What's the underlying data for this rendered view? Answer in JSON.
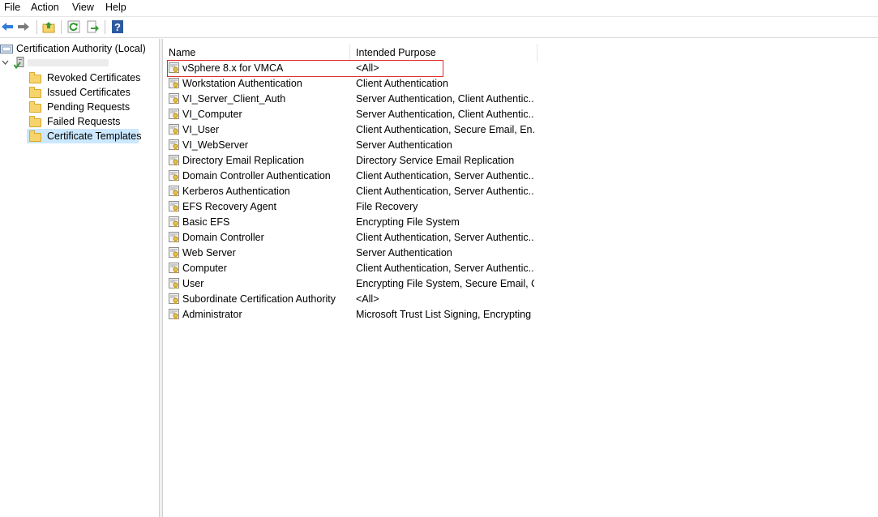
{
  "menu": [
    "File",
    "Action",
    "View",
    "Help"
  ],
  "toolbar": {
    "icons": [
      "back-icon",
      "forward-icon",
      "up-folder-icon",
      "refresh-icon",
      "export-list-icon",
      "help-icon"
    ],
    "help_glyph": "?"
  },
  "tree": {
    "root": "Certification Authority (Local)",
    "ca_name": "",
    "children": [
      "Revoked Certificates",
      "Issued Certificates",
      "Pending Requests",
      "Failed Requests",
      "Certificate Templates"
    ],
    "selected": "Certificate Templates"
  },
  "list": {
    "columns": [
      "Name",
      "Intended Purpose"
    ],
    "rows": [
      {
        "name": "vSphere 8.x for VMCA",
        "purpose": "<All>"
      },
      {
        "name": "Workstation Authentication",
        "purpose": "Client Authentication"
      },
      {
        "name": "VI_Server_Client_Auth",
        "purpose": "Server Authentication, Client Authentic..."
      },
      {
        "name": "VI_Computer",
        "purpose": "Server Authentication, Client Authentic..."
      },
      {
        "name": "VI_User",
        "purpose": "Client Authentication, Secure Email, En..."
      },
      {
        "name": "VI_WebServer",
        "purpose": "Server Authentication"
      },
      {
        "name": "Directory Email Replication",
        "purpose": "Directory Service Email Replication"
      },
      {
        "name": "Domain Controller Authentication",
        "purpose": "Client Authentication, Server Authentic..."
      },
      {
        "name": "Kerberos Authentication",
        "purpose": "Client Authentication, Server Authentic..."
      },
      {
        "name": "EFS Recovery Agent",
        "purpose": "File Recovery"
      },
      {
        "name": "Basic EFS",
        "purpose": "Encrypting File System"
      },
      {
        "name": "Domain Controller",
        "purpose": "Client Authentication, Server Authentic..."
      },
      {
        "name": "Web Server",
        "purpose": "Server Authentication"
      },
      {
        "name": "Computer",
        "purpose": "Client Authentication, Server Authentic..."
      },
      {
        "name": "User",
        "purpose": "Encrypting File System, Secure Email, Cl..."
      },
      {
        "name": "Subordinate Certification Authority",
        "purpose": "<All>"
      },
      {
        "name": "Administrator",
        "purpose": "Microsoft Trust List Signing, Encrypting ..."
      }
    ],
    "highlighted_row": "vSphere 8.x for VMCA",
    "highlight_color": "#e03030"
  },
  "colors": {
    "selection": "#cce8ff",
    "folder": "#f6d46b",
    "help_blue": "#2c5aa0"
  }
}
